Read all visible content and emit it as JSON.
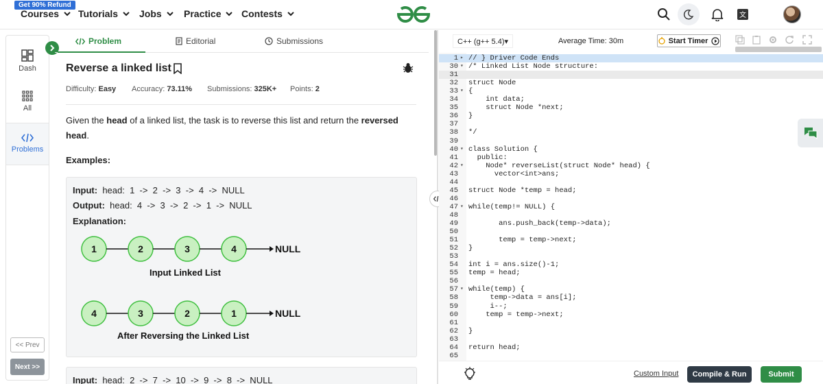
{
  "nav": {
    "promo": "Get 90% Refund",
    "items": [
      "Courses",
      "Tutorials",
      "Jobs",
      "Practice",
      "Contests"
    ]
  },
  "rail": {
    "dash": "Dash",
    "all": "All",
    "problems": "Problems",
    "prev": "<< Prev",
    "next": "Next >>"
  },
  "tabs": {
    "problem": "Problem",
    "editorial": "Editorial",
    "submissions": "Submissions"
  },
  "problem": {
    "title": "Reverse a linked list",
    "difficulty_label": "Difficulty:",
    "difficulty": "Easy",
    "accuracy_label": "Accuracy:",
    "accuracy": "73.11%",
    "submissions_label": "Submissions:",
    "submissions": "325K+",
    "points_label": "Points:",
    "points": "2",
    "desc_1": "Given the ",
    "desc_head": "head",
    "desc_2": " of a linked list, the task is to reverse this list and return the ",
    "desc_rev": "reversed head",
    "desc_3": ".",
    "examples": "Examples:",
    "ex1_input_label": "Input:",
    "ex1_input": "head:  1  ->  2  ->  3  ->  4  ->  NULL",
    "ex1_output_label": "Output:",
    "ex1_output": "head:  4  ->  3  ->  2  ->  1  ->  NULL",
    "explanation_label": "Explanation:",
    "list1": [
      "1",
      "2",
      "3",
      "4"
    ],
    "list2": [
      "4",
      "3",
      "2",
      "1"
    ],
    "null": "NULL",
    "cap1": "Input Linked List",
    "cap2": "After Reversing the Linked List",
    "ex2_input_label": "Input:",
    "ex2_input": "head:  2  ->  7  ->  10  ->  9  ->  8  ->  NULL"
  },
  "editor": {
    "language": "C++ (g++ 5.4)",
    "avg_time": "Average Time: 30m",
    "start_timer": "Start Timer",
    "lines": [
      {
        "n": "1",
        "fold": "▸",
        "t": "// } Driver Code Ends",
        "cls": "hl",
        "tag": "cm"
      },
      {
        "n": "30",
        "fold": "▾",
        "t": "/* Linked List Node structure:",
        "tag": "cm"
      },
      {
        "n": "31",
        "t": "",
        "cls": "cur"
      },
      {
        "n": "32",
        "t": "struct Node",
        "tag": "cm"
      },
      {
        "n": "33",
        "fold": "▾",
        "t": "{",
        "tag": "cm"
      },
      {
        "n": "34",
        "t": "    int data;",
        "tag": "cm"
      },
      {
        "n": "35",
        "t": "    struct Node *next;",
        "tag": "cm"
      },
      {
        "n": "36",
        "t": "}",
        "tag": "cm"
      },
      {
        "n": "37",
        "t": ""
      },
      {
        "n": "38",
        "t": "*/",
        "tag": "cm"
      },
      {
        "n": "39",
        "t": ""
      },
      {
        "n": "40",
        "fold": "▾",
        "t": "class Solution {"
      },
      {
        "n": "41",
        "t": "  public:",
        "tag": "kw"
      },
      {
        "n": "42",
        "fold": "▾",
        "t": "    Node* reverseList(struct Node* head) {"
      },
      {
        "n": "43",
        "t": "      vector<int>ans;"
      },
      {
        "n": "44",
        "t": ""
      },
      {
        "n": "45",
        "t": "struct Node *temp = head;"
      },
      {
        "n": "46",
        "t": ""
      },
      {
        "n": "47",
        "fold": "▾",
        "t": "while(temp!= NULL) {"
      },
      {
        "n": "48",
        "t": ""
      },
      {
        "n": "49",
        "t": "       ans.push_back(temp->data);"
      },
      {
        "n": "50",
        "t": ""
      },
      {
        "n": "51",
        "t": "       temp = temp->next;"
      },
      {
        "n": "52",
        "t": "}"
      },
      {
        "n": "53",
        "t": ""
      },
      {
        "n": "54",
        "t": "int i = ans.size()-1;"
      },
      {
        "n": "55",
        "t": "temp = head;"
      },
      {
        "n": "56",
        "t": ""
      },
      {
        "n": "57",
        "fold": "▾",
        "t": "while(temp) {"
      },
      {
        "n": "58",
        "t": "     temp->data = ans[i];"
      },
      {
        "n": "59",
        "t": "     i--;"
      },
      {
        "n": "60",
        "t": "    temp = temp->next;"
      },
      {
        "n": "61",
        "t": ""
      },
      {
        "n": "62",
        "t": "}"
      },
      {
        "n": "63",
        "t": ""
      },
      {
        "n": "64",
        "t": "return head;"
      },
      {
        "n": "65",
        "t": ""
      }
    ],
    "custom_input": "Custom Input",
    "compile_run": "Compile & Run",
    "submit": "Submit"
  },
  "colors": {
    "brand_green": "#2f8d46",
    "node_fill": "#c9f0c1",
    "node_stroke": "#3fbf3f"
  }
}
